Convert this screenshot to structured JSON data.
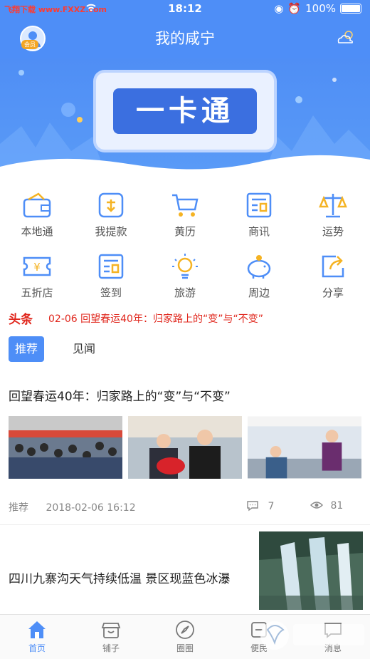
{
  "status_bar": {
    "watermark": "飞翔下载 www.FXXZ.com",
    "time": "18:12",
    "battery": "100%"
  },
  "header": {
    "title": "我的咸宁",
    "badge": "会员"
  },
  "banner": {
    "text": "一卡通"
  },
  "grid": [
    {
      "label": "本地通",
      "icon": "wallet-icon"
    },
    {
      "label": "我提款",
      "icon": "withdraw-icon"
    },
    {
      "label": "黄历",
      "icon": "cart-icon"
    },
    {
      "label": "商讯",
      "icon": "news-icon"
    },
    {
      "label": "运势",
      "icon": "scale-icon"
    },
    {
      "label": "五折店",
      "icon": "coupon-icon"
    },
    {
      "label": "签到",
      "icon": "checkin-icon"
    },
    {
      "label": "旅游",
      "icon": "bulb-icon"
    },
    {
      "label": "周边",
      "icon": "piggy-icon"
    },
    {
      "label": "分享",
      "icon": "share-icon"
    }
  ],
  "ticker": {
    "logo": "头条",
    "text": "02-06 回望春运40年：归家路上的“变”与“不变”"
  },
  "tabs": {
    "active": "推荐",
    "second": "见闻"
  },
  "article1": {
    "title": "回望春运40年：归家路上的“变”与“不变”",
    "tag": "推荐",
    "date": "2018-02-06 16:12",
    "comments": "7",
    "views": "81"
  },
  "article2": {
    "title": "四川九寨沟天气持续低温 景区现蓝色冰瀑"
  },
  "nav": [
    {
      "label": "首页"
    },
    {
      "label": "铺子"
    },
    {
      "label": "圈圈"
    },
    {
      "label": "便民"
    },
    {
      "label": "消息"
    }
  ],
  "colors": {
    "primary": "#4e8ef7",
    "ticker_red": "#e0251b"
  }
}
